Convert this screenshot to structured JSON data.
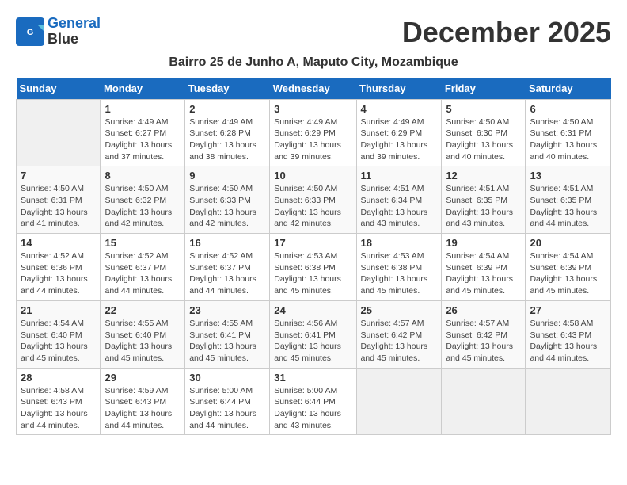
{
  "logo": {
    "line1": "General",
    "line2": "Blue"
  },
  "title": "December 2025",
  "location": "Bairro 25 de Junho A, Maputo City, Mozambique",
  "days_header": [
    "Sunday",
    "Monday",
    "Tuesday",
    "Wednesday",
    "Thursday",
    "Friday",
    "Saturday"
  ],
  "weeks": [
    [
      {
        "day": "",
        "text": ""
      },
      {
        "day": "1",
        "text": "Sunrise: 4:49 AM\nSunset: 6:27 PM\nDaylight: 13 hours\nand 37 minutes."
      },
      {
        "day": "2",
        "text": "Sunrise: 4:49 AM\nSunset: 6:28 PM\nDaylight: 13 hours\nand 38 minutes."
      },
      {
        "day": "3",
        "text": "Sunrise: 4:49 AM\nSunset: 6:29 PM\nDaylight: 13 hours\nand 39 minutes."
      },
      {
        "day": "4",
        "text": "Sunrise: 4:49 AM\nSunset: 6:29 PM\nDaylight: 13 hours\nand 39 minutes."
      },
      {
        "day": "5",
        "text": "Sunrise: 4:50 AM\nSunset: 6:30 PM\nDaylight: 13 hours\nand 40 minutes."
      },
      {
        "day": "6",
        "text": "Sunrise: 4:50 AM\nSunset: 6:31 PM\nDaylight: 13 hours\nand 40 minutes."
      }
    ],
    [
      {
        "day": "7",
        "text": "Sunrise: 4:50 AM\nSunset: 6:31 PM\nDaylight: 13 hours\nand 41 minutes."
      },
      {
        "day": "8",
        "text": "Sunrise: 4:50 AM\nSunset: 6:32 PM\nDaylight: 13 hours\nand 42 minutes."
      },
      {
        "day": "9",
        "text": "Sunrise: 4:50 AM\nSunset: 6:33 PM\nDaylight: 13 hours\nand 42 minutes."
      },
      {
        "day": "10",
        "text": "Sunrise: 4:50 AM\nSunset: 6:33 PM\nDaylight: 13 hours\nand 42 minutes."
      },
      {
        "day": "11",
        "text": "Sunrise: 4:51 AM\nSunset: 6:34 PM\nDaylight: 13 hours\nand 43 minutes."
      },
      {
        "day": "12",
        "text": "Sunrise: 4:51 AM\nSunset: 6:35 PM\nDaylight: 13 hours\nand 43 minutes."
      },
      {
        "day": "13",
        "text": "Sunrise: 4:51 AM\nSunset: 6:35 PM\nDaylight: 13 hours\nand 44 minutes."
      }
    ],
    [
      {
        "day": "14",
        "text": "Sunrise: 4:52 AM\nSunset: 6:36 PM\nDaylight: 13 hours\nand 44 minutes."
      },
      {
        "day": "15",
        "text": "Sunrise: 4:52 AM\nSunset: 6:37 PM\nDaylight: 13 hours\nand 44 minutes."
      },
      {
        "day": "16",
        "text": "Sunrise: 4:52 AM\nSunset: 6:37 PM\nDaylight: 13 hours\nand 44 minutes."
      },
      {
        "day": "17",
        "text": "Sunrise: 4:53 AM\nSunset: 6:38 PM\nDaylight: 13 hours\nand 45 minutes."
      },
      {
        "day": "18",
        "text": "Sunrise: 4:53 AM\nSunset: 6:38 PM\nDaylight: 13 hours\nand 45 minutes."
      },
      {
        "day": "19",
        "text": "Sunrise: 4:54 AM\nSunset: 6:39 PM\nDaylight: 13 hours\nand 45 minutes."
      },
      {
        "day": "20",
        "text": "Sunrise: 4:54 AM\nSunset: 6:39 PM\nDaylight: 13 hours\nand 45 minutes."
      }
    ],
    [
      {
        "day": "21",
        "text": "Sunrise: 4:54 AM\nSunset: 6:40 PM\nDaylight: 13 hours\nand 45 minutes."
      },
      {
        "day": "22",
        "text": "Sunrise: 4:55 AM\nSunset: 6:40 PM\nDaylight: 13 hours\nand 45 minutes."
      },
      {
        "day": "23",
        "text": "Sunrise: 4:55 AM\nSunset: 6:41 PM\nDaylight: 13 hours\nand 45 minutes."
      },
      {
        "day": "24",
        "text": "Sunrise: 4:56 AM\nSunset: 6:41 PM\nDaylight: 13 hours\nand 45 minutes."
      },
      {
        "day": "25",
        "text": "Sunrise: 4:57 AM\nSunset: 6:42 PM\nDaylight: 13 hours\nand 45 minutes."
      },
      {
        "day": "26",
        "text": "Sunrise: 4:57 AM\nSunset: 6:42 PM\nDaylight: 13 hours\nand 45 minutes."
      },
      {
        "day": "27",
        "text": "Sunrise: 4:58 AM\nSunset: 6:43 PM\nDaylight: 13 hours\nand 44 minutes."
      }
    ],
    [
      {
        "day": "28",
        "text": "Sunrise: 4:58 AM\nSunset: 6:43 PM\nDaylight: 13 hours\nand 44 minutes."
      },
      {
        "day": "29",
        "text": "Sunrise: 4:59 AM\nSunset: 6:43 PM\nDaylight: 13 hours\nand 44 minutes."
      },
      {
        "day": "30",
        "text": "Sunrise: 5:00 AM\nSunset: 6:44 PM\nDaylight: 13 hours\nand 44 minutes."
      },
      {
        "day": "31",
        "text": "Sunrise: 5:00 AM\nSunset: 6:44 PM\nDaylight: 13 hours\nand 43 minutes."
      },
      {
        "day": "",
        "text": ""
      },
      {
        "day": "",
        "text": ""
      },
      {
        "day": "",
        "text": ""
      }
    ]
  ]
}
